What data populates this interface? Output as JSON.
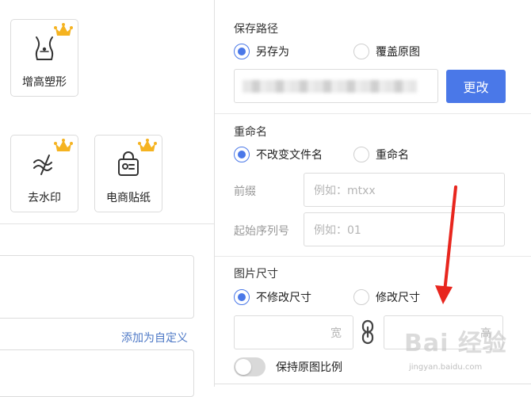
{
  "tools": [
    {
      "label": "增高塑形",
      "icon": "body-shape-icon",
      "premium": true
    },
    {
      "label": "去水印",
      "icon": "remove-watermark-icon",
      "premium": true
    },
    {
      "label": "电商贴纸",
      "icon": "shopping-bag-icon",
      "premium": true
    }
  ],
  "left": {
    "add_custom_link": "添加为自定义"
  },
  "save_path": {
    "title": "保存路径",
    "options": [
      "另存为",
      "覆盖原图"
    ],
    "selected": "另存为",
    "change_button": "更改"
  },
  "rename": {
    "title": "重命名",
    "options": [
      "不改变文件名",
      "重命名"
    ],
    "selected": "不改变文件名",
    "prefix_label": "前缀",
    "prefix_placeholder": "例如：mtxx",
    "start_label": "起始序列号",
    "start_placeholder": "例如：01"
  },
  "size": {
    "title": "图片尺寸",
    "options": [
      "不修改尺寸",
      "修改尺寸"
    ],
    "selected": "不修改尺寸",
    "width_placeholder": "宽",
    "height_placeholder": "高",
    "keep_ratio_label": "保持原图比例",
    "keep_ratio_on": false
  },
  "watermark": {
    "main": "Bai 经验",
    "sub": "jingyan.baidu.com"
  },
  "colors": {
    "accent": "#4a78e8",
    "arrow": "#e8261e"
  }
}
